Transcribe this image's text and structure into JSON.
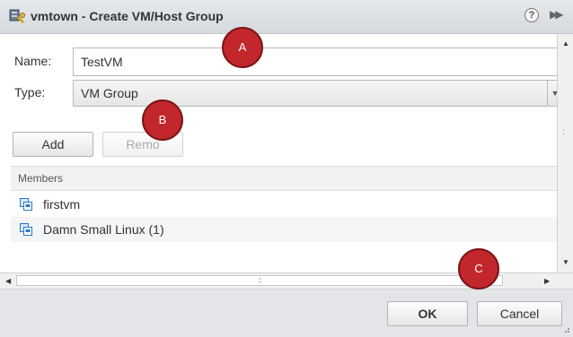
{
  "window": {
    "title": "vmtown - Create VM/Host Group",
    "help_glyph": "?",
    "forward_glyph": "▶▶"
  },
  "form": {
    "name_label": "Name:",
    "name_value": "TestVM",
    "type_label": "Type:",
    "type_value": "VM Group",
    "type_options": [
      "VM Group"
    ]
  },
  "toolbar": {
    "add_label": "Add",
    "remove_label": "Remo"
  },
  "members": {
    "header": "Members",
    "items": [
      {
        "label": "firstvm",
        "icon": "vm-icon"
      },
      {
        "label": "Damn Small Linux (1)",
        "icon": "vm-icon"
      }
    ]
  },
  "footer": {
    "ok_label": "OK",
    "cancel_label": "Cancel"
  },
  "markers": [
    {
      "label": "A"
    },
    {
      "label": "B"
    },
    {
      "label": "C"
    }
  ],
  "colors": {
    "marker": "#c1272d",
    "vm_icon": "#2a79c2"
  }
}
